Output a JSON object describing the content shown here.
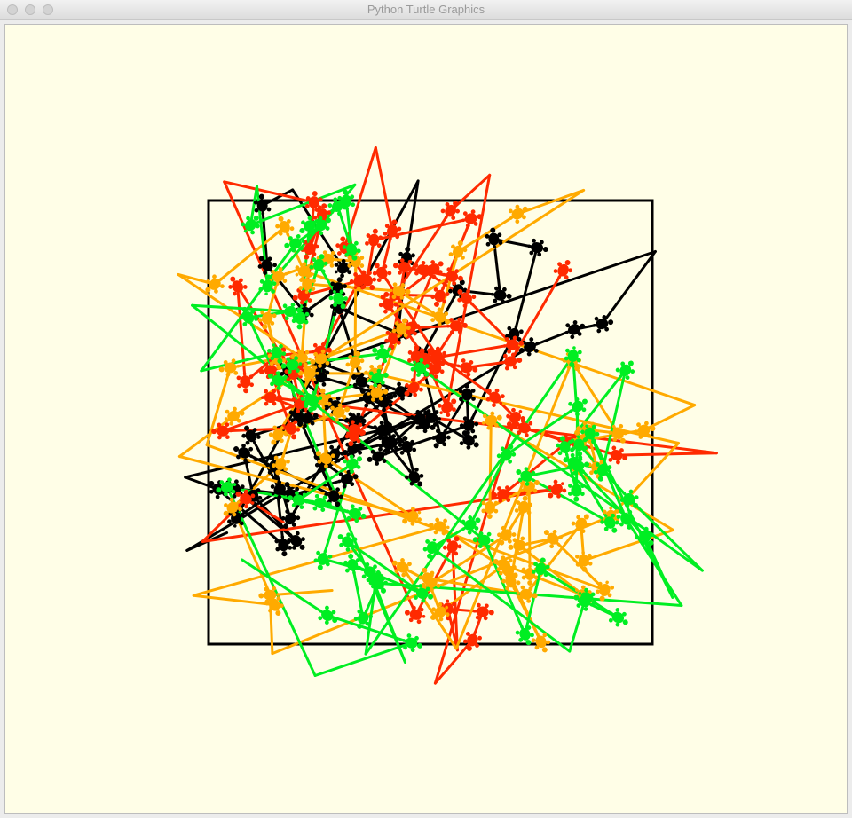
{
  "window": {
    "title": "Python Turtle Graphics"
  },
  "canvas": {
    "background": "#fffee7",
    "pen_colors": [
      "#000000",
      "#ff2a00",
      "#ffaa00",
      "#00ee22"
    ],
    "square_color": "#000000"
  },
  "icons": {
    "close": "close-icon",
    "minimize": "minimize-icon",
    "zoom": "zoom-icon",
    "turtle": "turtle-icon"
  }
}
